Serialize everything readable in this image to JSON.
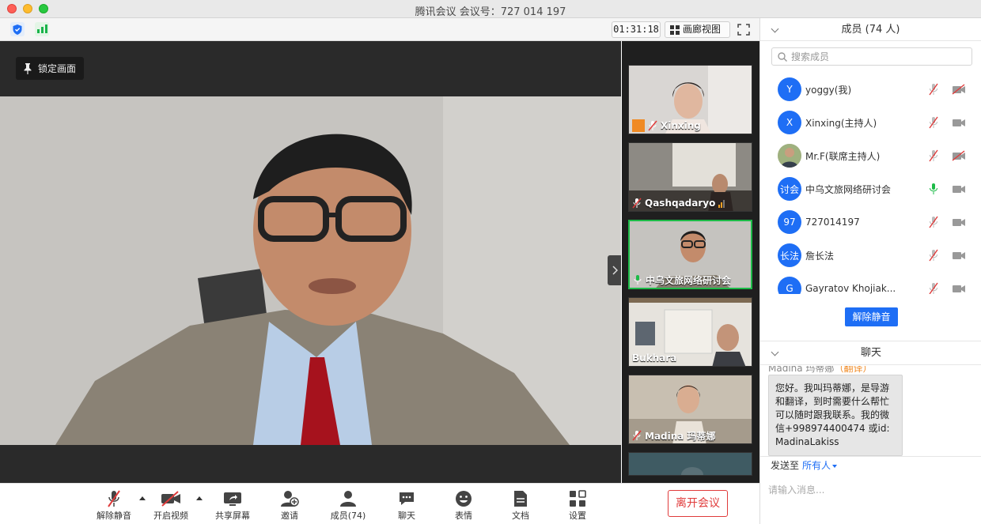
{
  "window": {
    "title": "腾讯会议 会议号：727 014 197"
  },
  "toolbar": {
    "timer": "01:31:18",
    "gallery_label": "画廊视图",
    "icons": [
      "shield-icon",
      "signal-icon",
      "fullscreen-icon"
    ]
  },
  "stage": {
    "lock_label": "锁定画面",
    "thumbnails": [
      {
        "name": "Xinxing",
        "muted": true,
        "active": false
      },
      {
        "name": "Qashqadaryo",
        "muted": true,
        "active": false
      },
      {
        "name": "中乌文旅网络研讨会",
        "muted": false,
        "active": true
      },
      {
        "name": "Bukhara",
        "muted": false,
        "active": false
      },
      {
        "name": "Madina 玛蒂娜",
        "muted": true,
        "active": false
      }
    ]
  },
  "controls": {
    "unmute": "解除静音",
    "start_video": "开启视频",
    "share_screen": "共享屏幕",
    "invite": "邀请",
    "members": "成员(74)",
    "chat": "聊天",
    "reactions": "表情",
    "docs": "文档",
    "settings": "设置",
    "leave": "离开会议"
  },
  "members_panel": {
    "title": "成员 (74 人)",
    "search_placeholder": "搜索成员",
    "unmute_all": "解除静音",
    "members": [
      {
        "avatar": "Y",
        "name": "yoggy(我)",
        "mic": "muted",
        "cam": "off"
      },
      {
        "avatar": "X",
        "name": "Xinxing(主持人)",
        "mic": "muted",
        "cam": "on"
      },
      {
        "avatar": "",
        "name": "Mr.F(联席主持人)",
        "mic": "muted",
        "cam": "off"
      },
      {
        "avatar": "讨会",
        "name": "中乌文旅网络研讨会",
        "mic": "active",
        "cam": "on"
      },
      {
        "avatar": "97",
        "name": "727014197",
        "mic": "muted",
        "cam": "on"
      },
      {
        "avatar": "长法",
        "name": "詹长法",
        "mic": "muted",
        "cam": "on"
      },
      {
        "avatar": "G",
        "name": "Gayratov Khojiak...",
        "mic": "muted",
        "cam": "on"
      }
    ]
  },
  "chat_panel": {
    "title": "聊天",
    "sender": "Madina 玛蒂娜",
    "sender_role": "（翻译）",
    "message": "您好。我叫玛蒂娜，是导游和翻译，到时需要什么帮忙可以随时跟我联系。我的微信+998974400474 或id: MadinaLakiss",
    "send_to_label": "发送至",
    "send_to_target": "所有人",
    "input_placeholder": "请输入消息..."
  },
  "colors": {
    "accent": "#1e6ef5",
    "leave": "#e03b3b",
    "active_speaker": "#1dbb48"
  }
}
